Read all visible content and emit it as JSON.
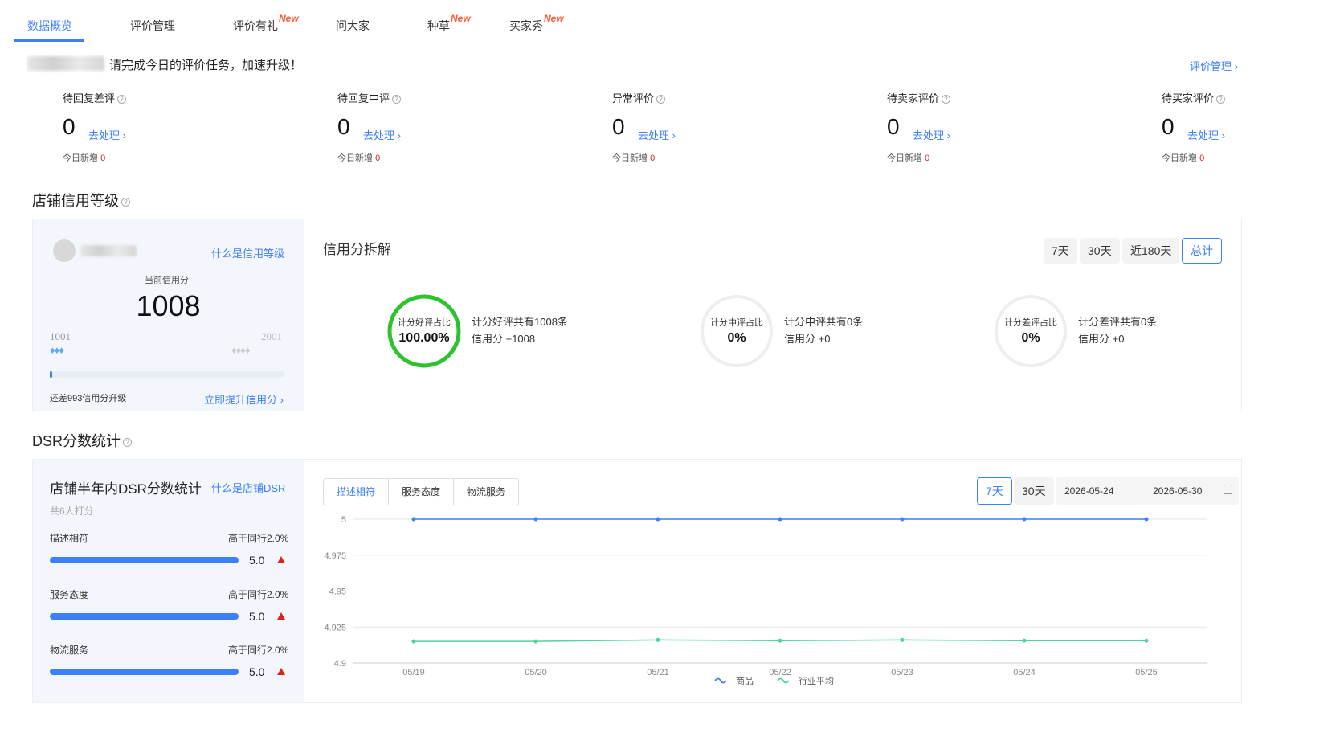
{
  "tabs": [
    {
      "label": "数据概览",
      "new": ""
    },
    {
      "label": "评价管理",
      "new": ""
    },
    {
      "label": "评价有礼",
      "new": "New"
    },
    {
      "label": "问大家",
      "new": ""
    },
    {
      "label": "种草",
      "new": "New"
    },
    {
      "label": "买家秀",
      "new": "New"
    }
  ],
  "notice": {
    "text": "请完成今日的评价任务，加速升级！",
    "manage_link": "评价管理 ›"
  },
  "stats": [
    {
      "label": "待回复差评",
      "value": "0",
      "action": "去处理 ›",
      "today_label": "今日新增",
      "today_value": "0"
    },
    {
      "label": "待回复中评",
      "value": "0",
      "action": "去处理 ›",
      "today_label": "今日新增",
      "today_value": "0"
    },
    {
      "label": "异常评价",
      "value": "0",
      "action": "去处理 ›",
      "today_label": "今日新增",
      "today_value": "0"
    },
    {
      "label": "待卖家评价",
      "value": "0",
      "action": "去处理 ›",
      "today_label": "今日新增",
      "today_value": "0"
    },
    {
      "label": "待买家评价",
      "value": "0",
      "action": "去处理 ›",
      "today_label": "今日新增",
      "today_value": "0"
    }
  ],
  "credit_section": {
    "title": "店铺信用等级",
    "what_link": "什么是信用等级",
    "current_label": "当前信用分",
    "score": "1008",
    "min_label": "1001",
    "max_label": "2001",
    "progress_fraction": 0.007,
    "upgrade_text": "还差993信用分升级",
    "upgrade_link": "立即提升信用分 ›"
  },
  "breakdown": {
    "title": "信用分拆解",
    "periods": [
      "7天",
      "30天",
      "近180天",
      "总计"
    ],
    "active_period": "总计",
    "items": [
      {
        "ring_label": "计分好评占比",
        "ring_value": "100.00%",
        "fraction": 1.0,
        "color": "#2fc22f",
        "line1": "计分好评共有1008条",
        "line2": "信用分 +1008"
      },
      {
        "ring_label": "计分中评占比",
        "ring_value": "0%",
        "fraction": 0,
        "color": "#2fc22f",
        "line1": "计分中评共有0条",
        "line2": "信用分 +0"
      },
      {
        "ring_label": "计分差评占比",
        "ring_value": "0%",
        "fraction": 0,
        "color": "#2fc22f",
        "line1": "计分差评共有0条",
        "line2": "信用分 +0"
      }
    ]
  },
  "dsr_section": {
    "title": "DSR分数统计",
    "card_title": "店铺半年内DSR分数统计",
    "what_link": "什么是店铺DSR",
    "raters": "共6人打分",
    "metrics": [
      {
        "name": "描述相符",
        "compare": "高于同行2.0%",
        "score": "5.0",
        "fraction": 1.0
      },
      {
        "name": "服务态度",
        "compare": "高于同行2.0%",
        "score": "5.0",
        "fraction": 1.0
      },
      {
        "name": "物流服务",
        "compare": "高于同行2.0%",
        "score": "5.0",
        "fraction": 1.0
      }
    ],
    "chart_tabs": [
      "描述相符",
      "服务态度",
      "物流服务"
    ],
    "active_chart_tab": "描述相符",
    "range_buttons": [
      "7天",
      "30天"
    ],
    "active_range": "7天",
    "date_from": "2026-05-24",
    "date_to": "2026-05-30"
  },
  "colors": {
    "accent": "#3d7ff7",
    "good": "#2fc22f",
    "industry": "#4dd4a0",
    "alert": "#e02020"
  },
  "chart_data": {
    "type": "line",
    "x": [
      "05/19",
      "05/20",
      "05/21",
      "05/22",
      "05/23",
      "05/24",
      "05/25"
    ],
    "ylim": [
      4.9,
      5
    ],
    "yticks": [
      "5",
      "4.975",
      "4.95",
      "4.925",
      "4.9"
    ],
    "grid": true,
    "legend_position": "bottom",
    "series": [
      {
        "name": "商品",
        "color": "#3d7ff7",
        "values": [
          5,
          5,
          5,
          5,
          5,
          5,
          5
        ]
      },
      {
        "name": "行业平均",
        "color": "#4dd4a0",
        "values": [
          4.915,
          4.915,
          4.916,
          4.9155,
          4.916,
          4.9155,
          4.9155
        ]
      }
    ]
  }
}
